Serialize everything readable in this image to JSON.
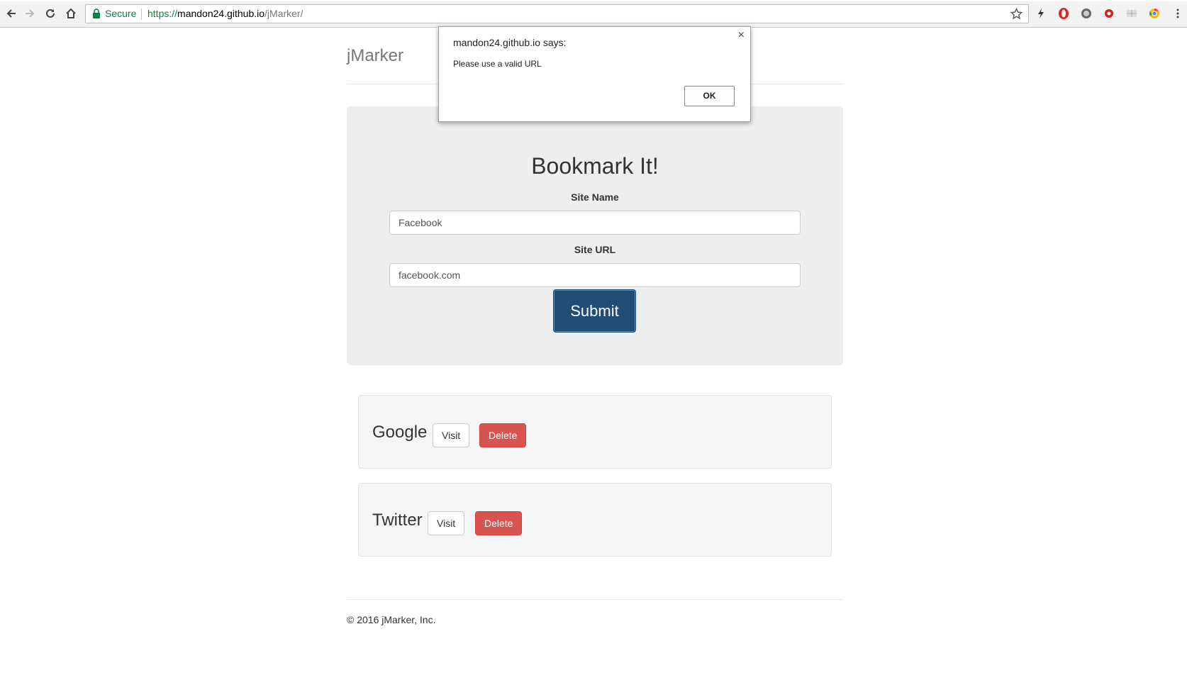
{
  "browser": {
    "secure_label": "Secure",
    "url_scheme": "https://",
    "url_host": "mandon24.github.io",
    "url_path": "/jMarker/"
  },
  "page": {
    "brand": "jMarker",
    "form": {
      "title": "Bookmark It!",
      "site_name_label": "Site Name",
      "site_name_value": "Facebook",
      "site_url_label": "Site URL",
      "site_url_value": "facebook.com",
      "submit_label": "Submit"
    },
    "bookmarks": [
      {
        "name": "Google",
        "visit_label": "Visit",
        "delete_label": "Delete"
      },
      {
        "name": "Twitter",
        "visit_label": "Visit",
        "delete_label": "Delete"
      }
    ],
    "footer": "© 2016 jMarker, Inc."
  },
  "dialog": {
    "title": "mandon24.github.io says:",
    "message": "Please use a valid URL",
    "ok_label": "OK",
    "close_glyph": "×"
  },
  "colors": {
    "submit": "#204d74",
    "delete": "#d9534f",
    "jumbotron": "#eeeeee",
    "secure_green": "#0b8043"
  },
  "icons": [
    "back-arrow-icon",
    "forward-arrow-icon",
    "reload-icon",
    "home-icon",
    "lock-icon",
    "star-icon",
    "flash-extension-icon",
    "opera-extension-icon",
    "globe-extension-icon",
    "gear-extension-icon",
    "grid-extension-icon",
    "chrome-extension-icon",
    "menu-dots-icon"
  ]
}
